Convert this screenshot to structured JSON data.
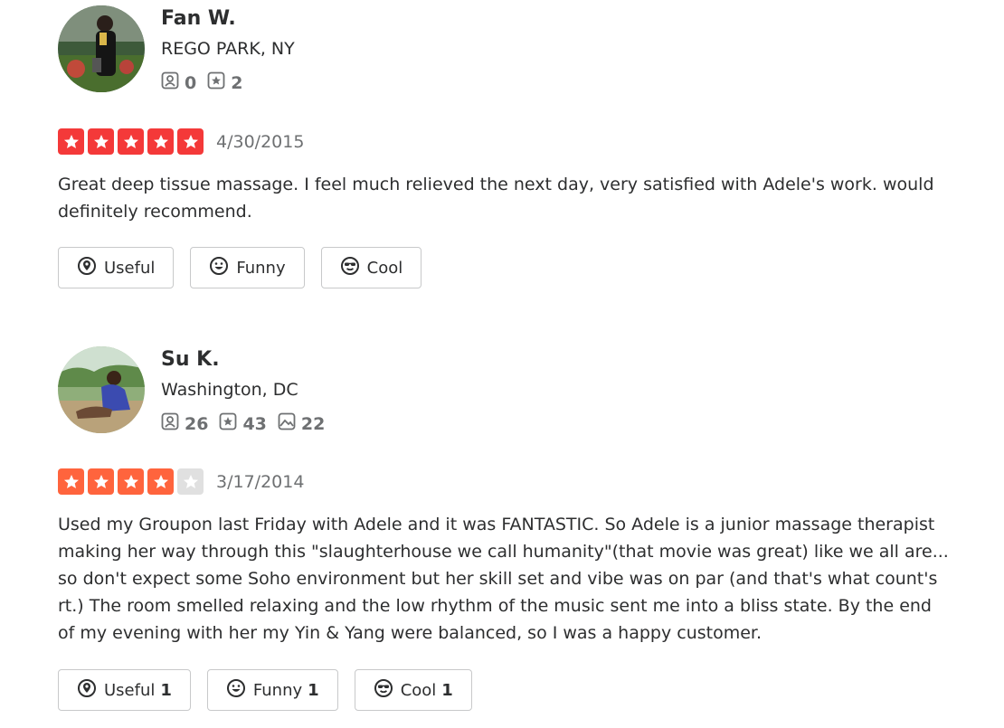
{
  "reviews": [
    {
      "user": {
        "name": "Fan W.",
        "location": "REGO PARK, NY",
        "friends": "0",
        "reviews": "2",
        "photos": null
      },
      "rating": 5,
      "date": "4/30/2015",
      "text": "Great deep tissue massage. I feel much relieved the next day, very satisfied with Adele's work. would definitely recommend.",
      "buttons": {
        "useful_label": "Useful",
        "useful_count": "",
        "funny_label": "Funny",
        "funny_count": "",
        "cool_label": "Cool",
        "cool_count": ""
      }
    },
    {
      "user": {
        "name": "Su K.",
        "location": "Washington, DC",
        "friends": "26",
        "reviews": "43",
        "photos": "22"
      },
      "rating": 4,
      "date": "3/17/2014",
      "text": "Used my Groupon last Friday with Adele and it was FANTASTIC. So Adele is a junior massage therapist making her way through this \"slaughterhouse we call humanity\"(that movie was great) like we all are... so don't expect some Soho environment but her skill set and vibe was on par (and that's what count's rt.) The room smelled relaxing and the low rhythm of the music sent me into a bliss state. By the end of my evening with her my Yin & Yang were balanced, so I was a happy customer.",
      "buttons": {
        "useful_label": "Useful",
        "useful_count": "1",
        "funny_label": "Funny",
        "funny_count": "1",
        "cool_label": "Cool",
        "cool_count": "1"
      }
    }
  ],
  "colors": {
    "star_5": "#f43939",
    "star_4": "#ff643d",
    "star_empty": "#e0e0e0",
    "muted_text": "#6e7072"
  },
  "icons": {
    "friends": "friends-icon",
    "reviews": "review-star-icon",
    "photos": "photo-icon",
    "useful": "useful-icon",
    "funny": "funny-icon",
    "cool": "cool-icon"
  }
}
